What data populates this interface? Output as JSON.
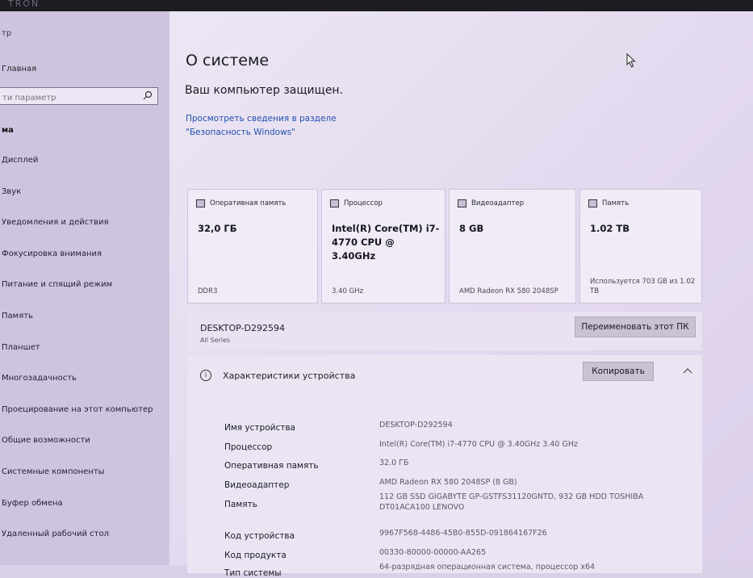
{
  "topbar": {
    "brand": "TRON"
  },
  "sidebar": {
    "crumb": "тр",
    "home": "Главная",
    "search_placeholder": "ти параметр",
    "section": "ма",
    "items": [
      {
        "label": "Дисплей"
      },
      {
        "label": "Звук"
      },
      {
        "label": "Уведомления и действия"
      },
      {
        "label": "Фокусировка внимания"
      },
      {
        "label": "Питание и спящий режим"
      },
      {
        "label": "Память"
      },
      {
        "label": "Планшет"
      },
      {
        "label": "Многозадачность"
      },
      {
        "label": "Проецирование на этот компьютер"
      },
      {
        "label": "Общие возможности"
      },
      {
        "label": "Системные компоненты"
      },
      {
        "label": "Буфер обмена"
      },
      {
        "label": "Удаленный рабочий стол"
      }
    ]
  },
  "main": {
    "title": "О системе",
    "protected": "Ваш компьютер защищен.",
    "security_link": "Просмотреть сведения в разделе \"Безопасность Windows\""
  },
  "cards": [
    {
      "header": "Оперативная память",
      "value": "32,0 ГБ",
      "sub": "DDR3",
      "icon": "ram-icon"
    },
    {
      "header": "Процессор",
      "value": "Intel(R) Core(TM) i7-4770 CPU @ 3.40GHz",
      "sub": "3.40 GHz",
      "icon": "processor-icon"
    },
    {
      "header": "Видеоадаптер",
      "value": "8 GB",
      "sub": "AMD Radeon RX 580 2048SP",
      "icon": "gpu-icon"
    },
    {
      "header": "Память",
      "value": "1.02 TB",
      "sub": "Используется 703 GB из 1.02 TB",
      "icon": "storage-icon"
    }
  ],
  "pc": {
    "name": "DESKTOP-D292594",
    "model": "All Series",
    "rename_label": "Переименовать этот ПК"
  },
  "specs": {
    "header": "Характеристики устройства",
    "copy_label": "Копировать",
    "rows": [
      {
        "key": "Имя устройства",
        "value": "DESKTOP-D292594"
      },
      {
        "key": "Процессор",
        "value": "Intel(R) Core(TM) i7-4770 CPU @ 3.40GHz   3.40 GHz"
      },
      {
        "key": "Оперативная память",
        "value": "32.0 ГБ"
      },
      {
        "key": "Видеоадаптер",
        "value": "AMD Radeon RX 580 2048SP (8 GB)"
      },
      {
        "key": "Память",
        "value": "112 GB SSD GIGABYTE GP-GSTFS31120GNTD, 932 GB HDD TOSHIBA DT01ACA100          LENOVO"
      },
      {
        "key": "Код устройства",
        "value": "9967F568-4486-45B0-855D-091864167F26"
      },
      {
        "key": "Код продукта",
        "value": "00330-80000-00000-AA265"
      },
      {
        "key": "Тип системы",
        "value": "64-разрядная операционная система, процессор x64"
      }
    ]
  }
}
